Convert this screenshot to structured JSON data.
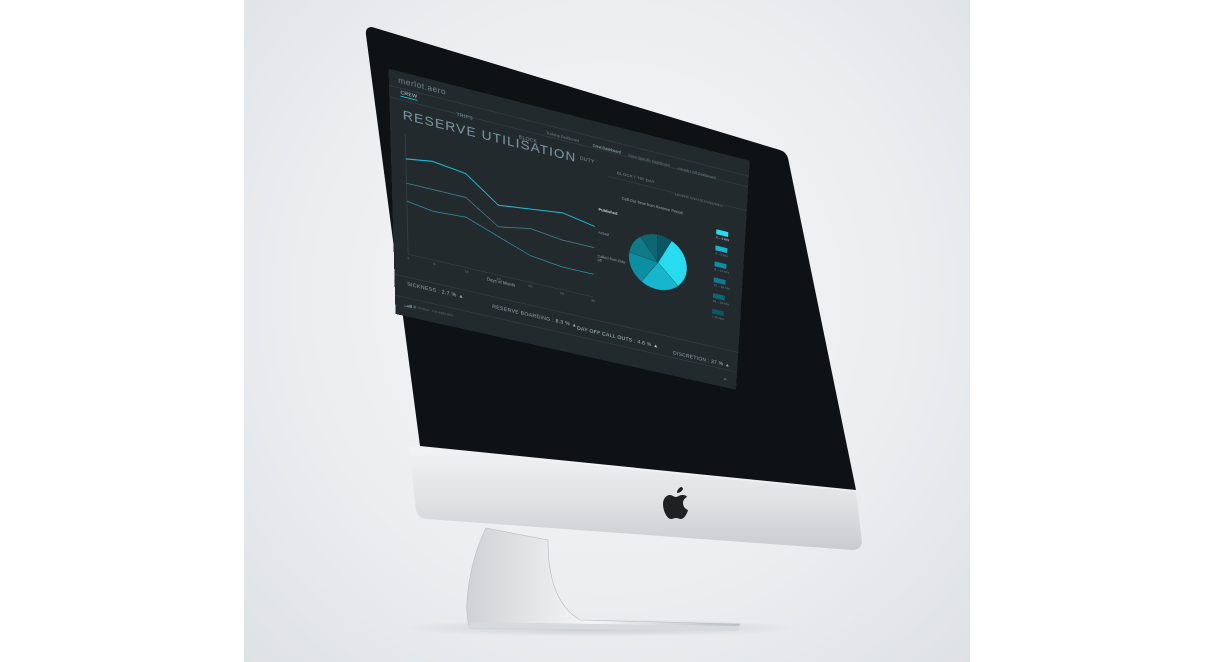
{
  "app": {
    "logo": "merlot.aero",
    "nav": [
      "CREW",
      "TRIPS",
      "BLOCK",
      "DUTY"
    ],
    "subnav": [
      "Training Dashboard",
      "Crew Dashboard",
      "Crew Specific Dashboard",
      "Aircraft / Off Dashboard"
    ],
    "tabs": [
      "BLOCK / TIP DAY",
      "LEAVE OUTSTANDING"
    ],
    "title": "RESERVE UTILISATION"
  },
  "chart_data": [
    {
      "type": "line",
      "xlabel": "Days of Month",
      "x": [
        1,
        5,
        10,
        15,
        20,
        25,
        30
      ],
      "series": [
        {
          "name": "Published",
          "color": "#19c6dc",
          "values": [
            88,
            90,
            88,
            76,
            78,
            80,
            77
          ]
        },
        {
          "name": "Actual",
          "color": "#4d8a94",
          "values": [
            76,
            76,
            76,
            65,
            68,
            66,
            66
          ]
        },
        {
          "name": "Called from Day off",
          "color": "#2c9db0",
          "values": [
            67,
            65,
            66,
            60,
            54,
            52,
            52
          ]
        }
      ]
    },
    {
      "type": "pie",
      "title": "Call-Out Time from Reserve Period",
      "slices": [
        {
          "label": "0 – 4 Hrs",
          "value": 30,
          "color": "#28dbee"
        },
        {
          "label": "4 – 8 Hrs",
          "value": 22,
          "color": "#16b6cc"
        },
        {
          "label": "8 – 12 Hrs",
          "value": 18,
          "color": "#0d8fa2"
        },
        {
          "label": "12 – 16 Hrs",
          "value": 12,
          "color": "#117a89"
        },
        {
          "label": "16 – 20 Hrs",
          "value": 10,
          "color": "#0c6674"
        },
        {
          "label": "> 20 Hrs",
          "value": 8,
          "color": "#0b5662"
        }
      ]
    }
  ],
  "metrics": {
    "sickness": {
      "label": "SICKNESS :",
      "value": "2.7 %"
    },
    "reserve_boarding": {
      "label": "RESERVE BOARDING :",
      "value": "8.3 %"
    },
    "day_off_call_outs": {
      "label": "DAY OFF CALL OUTS :",
      "value": "4.6 %"
    },
    "discretion": {
      "label": "DISCRETION :",
      "value": "37 %"
    }
  },
  "footer": {
    "version": "Version : 0.5.4563.890"
  }
}
